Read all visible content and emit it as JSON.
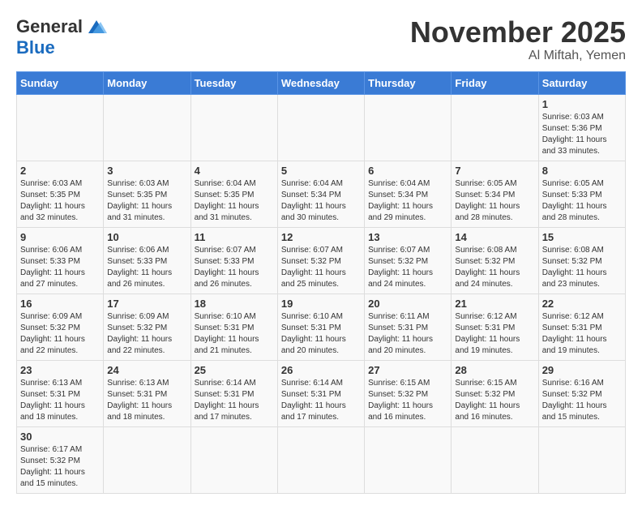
{
  "logo": {
    "general": "General",
    "blue": "Blue"
  },
  "title": "November 2025",
  "location": "Al Miftah, Yemen",
  "days_header": [
    "Sunday",
    "Monday",
    "Tuesday",
    "Wednesday",
    "Thursday",
    "Friday",
    "Saturday"
  ],
  "weeks": [
    [
      {
        "day": "",
        "info": ""
      },
      {
        "day": "",
        "info": ""
      },
      {
        "day": "",
        "info": ""
      },
      {
        "day": "",
        "info": ""
      },
      {
        "day": "",
        "info": ""
      },
      {
        "day": "",
        "info": ""
      },
      {
        "day": "1",
        "info": "Sunrise: 6:03 AM\nSunset: 5:36 PM\nDaylight: 11 hours\nand 33 minutes."
      }
    ],
    [
      {
        "day": "2",
        "info": "Sunrise: 6:03 AM\nSunset: 5:35 PM\nDaylight: 11 hours\nand 32 minutes."
      },
      {
        "day": "3",
        "info": "Sunrise: 6:03 AM\nSunset: 5:35 PM\nDaylight: 11 hours\nand 31 minutes."
      },
      {
        "day": "4",
        "info": "Sunrise: 6:04 AM\nSunset: 5:35 PM\nDaylight: 11 hours\nand 31 minutes."
      },
      {
        "day": "5",
        "info": "Sunrise: 6:04 AM\nSunset: 5:34 PM\nDaylight: 11 hours\nand 30 minutes."
      },
      {
        "day": "6",
        "info": "Sunrise: 6:04 AM\nSunset: 5:34 PM\nDaylight: 11 hours\nand 29 minutes."
      },
      {
        "day": "7",
        "info": "Sunrise: 6:05 AM\nSunset: 5:34 PM\nDaylight: 11 hours\nand 28 minutes."
      },
      {
        "day": "8",
        "info": "Sunrise: 6:05 AM\nSunset: 5:33 PM\nDaylight: 11 hours\nand 28 minutes."
      }
    ],
    [
      {
        "day": "9",
        "info": "Sunrise: 6:06 AM\nSunset: 5:33 PM\nDaylight: 11 hours\nand 27 minutes."
      },
      {
        "day": "10",
        "info": "Sunrise: 6:06 AM\nSunset: 5:33 PM\nDaylight: 11 hours\nand 26 minutes."
      },
      {
        "day": "11",
        "info": "Sunrise: 6:07 AM\nSunset: 5:33 PM\nDaylight: 11 hours\nand 26 minutes."
      },
      {
        "day": "12",
        "info": "Sunrise: 6:07 AM\nSunset: 5:32 PM\nDaylight: 11 hours\nand 25 minutes."
      },
      {
        "day": "13",
        "info": "Sunrise: 6:07 AM\nSunset: 5:32 PM\nDaylight: 11 hours\nand 24 minutes."
      },
      {
        "day": "14",
        "info": "Sunrise: 6:08 AM\nSunset: 5:32 PM\nDaylight: 11 hours\nand 24 minutes."
      },
      {
        "day": "15",
        "info": "Sunrise: 6:08 AM\nSunset: 5:32 PM\nDaylight: 11 hours\nand 23 minutes."
      }
    ],
    [
      {
        "day": "16",
        "info": "Sunrise: 6:09 AM\nSunset: 5:32 PM\nDaylight: 11 hours\nand 22 minutes."
      },
      {
        "day": "17",
        "info": "Sunrise: 6:09 AM\nSunset: 5:32 PM\nDaylight: 11 hours\nand 22 minutes."
      },
      {
        "day": "18",
        "info": "Sunrise: 6:10 AM\nSunset: 5:31 PM\nDaylight: 11 hours\nand 21 minutes."
      },
      {
        "day": "19",
        "info": "Sunrise: 6:10 AM\nSunset: 5:31 PM\nDaylight: 11 hours\nand 20 minutes."
      },
      {
        "day": "20",
        "info": "Sunrise: 6:11 AM\nSunset: 5:31 PM\nDaylight: 11 hours\nand 20 minutes."
      },
      {
        "day": "21",
        "info": "Sunrise: 6:12 AM\nSunset: 5:31 PM\nDaylight: 11 hours\nand 19 minutes."
      },
      {
        "day": "22",
        "info": "Sunrise: 6:12 AM\nSunset: 5:31 PM\nDaylight: 11 hours\nand 19 minutes."
      }
    ],
    [
      {
        "day": "23",
        "info": "Sunrise: 6:13 AM\nSunset: 5:31 PM\nDaylight: 11 hours\nand 18 minutes."
      },
      {
        "day": "24",
        "info": "Sunrise: 6:13 AM\nSunset: 5:31 PM\nDaylight: 11 hours\nand 18 minutes."
      },
      {
        "day": "25",
        "info": "Sunrise: 6:14 AM\nSunset: 5:31 PM\nDaylight: 11 hours\nand 17 minutes."
      },
      {
        "day": "26",
        "info": "Sunrise: 6:14 AM\nSunset: 5:31 PM\nDaylight: 11 hours\nand 17 minutes."
      },
      {
        "day": "27",
        "info": "Sunrise: 6:15 AM\nSunset: 5:32 PM\nDaylight: 11 hours\nand 16 minutes."
      },
      {
        "day": "28",
        "info": "Sunrise: 6:15 AM\nSunset: 5:32 PM\nDaylight: 11 hours\nand 16 minutes."
      },
      {
        "day": "29",
        "info": "Sunrise: 6:16 AM\nSunset: 5:32 PM\nDaylight: 11 hours\nand 15 minutes."
      }
    ],
    [
      {
        "day": "30",
        "info": "Sunrise: 6:17 AM\nSunset: 5:32 PM\nDaylight: 11 hours\nand 15 minutes."
      },
      {
        "day": "",
        "info": ""
      },
      {
        "day": "",
        "info": ""
      },
      {
        "day": "",
        "info": ""
      },
      {
        "day": "",
        "info": ""
      },
      {
        "day": "",
        "info": ""
      },
      {
        "day": "",
        "info": ""
      }
    ]
  ]
}
